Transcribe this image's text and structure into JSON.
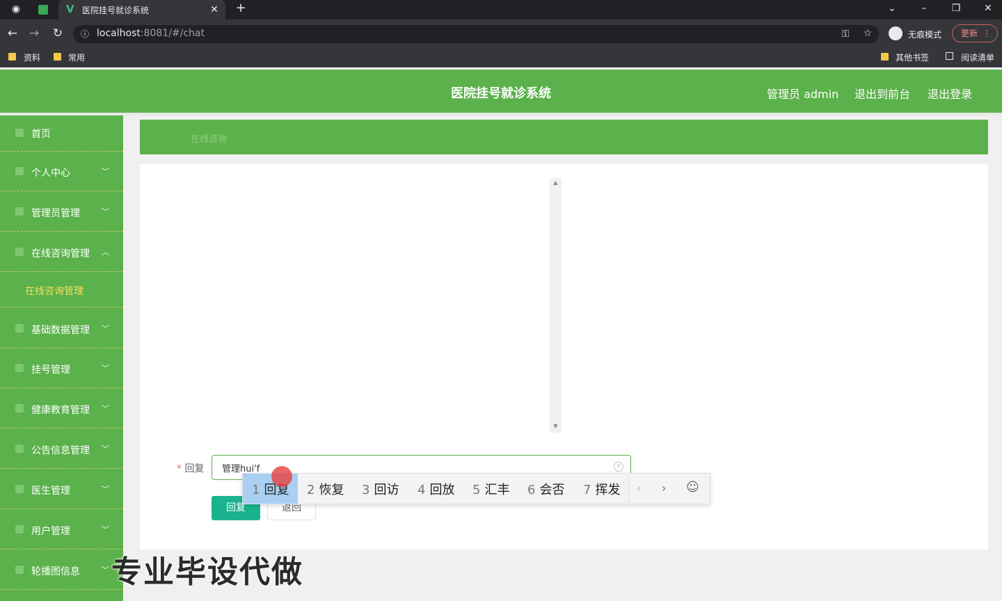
{
  "browser": {
    "tab_title": "医院挂号就诊系统",
    "url_host": "localhost",
    "url_rest": ":8081/#/chat",
    "incognito_label": "无痕模式",
    "update_label": "更新",
    "bookmarks": [
      "资料",
      "常用"
    ],
    "bookmarks_right": [
      "其他书签",
      "阅读清单"
    ]
  },
  "header": {
    "title": "医院挂号就诊系统",
    "user": "管理员 admin",
    "to_front": "退出到前台",
    "logout": "退出登录"
  },
  "sidebar": {
    "items": [
      {
        "label": "首页",
        "arrow": ""
      },
      {
        "label": "个人中心",
        "arrow": "﹀"
      },
      {
        "label": "管理员管理",
        "arrow": "﹀"
      },
      {
        "label": "在线咨询管理",
        "arrow": "︿"
      },
      {
        "label": "在线咨询管理"
      },
      {
        "label": "基础数据管理",
        "arrow": "﹀"
      },
      {
        "label": "挂号管理",
        "arrow": "﹀"
      },
      {
        "label": "健康教育管理",
        "arrow": "﹀"
      },
      {
        "label": "公告信息管理",
        "arrow": "﹀"
      },
      {
        "label": "医生管理",
        "arrow": "﹀"
      },
      {
        "label": "用户管理",
        "arrow": "﹀"
      },
      {
        "label": "轮播图信息",
        "arrow": "﹀"
      }
    ]
  },
  "breadcrumb": "在线咨询",
  "form": {
    "required_mark": "*",
    "reply_label": "回复",
    "reply_value": "管理hui'f",
    "reply_button": "回复",
    "back_button": "返回"
  },
  "ime": {
    "candidates": [
      {
        "num": "1",
        "text": "回复"
      },
      {
        "num": "2",
        "text": "恢复"
      },
      {
        "num": "3",
        "text": "回访"
      },
      {
        "num": "4",
        "text": "回放"
      },
      {
        "num": "5",
        "text": "汇丰"
      },
      {
        "num": "6",
        "text": "会否"
      },
      {
        "num": "7",
        "text": "挥发"
      }
    ],
    "prev": "‹",
    "next": "›",
    "emoji": "☺"
  },
  "watermark": "专业毕设代做",
  "colors": {
    "primary": "#5bb14b",
    "accent": "#19b38f",
    "submenu_text": "#f0e060"
  }
}
